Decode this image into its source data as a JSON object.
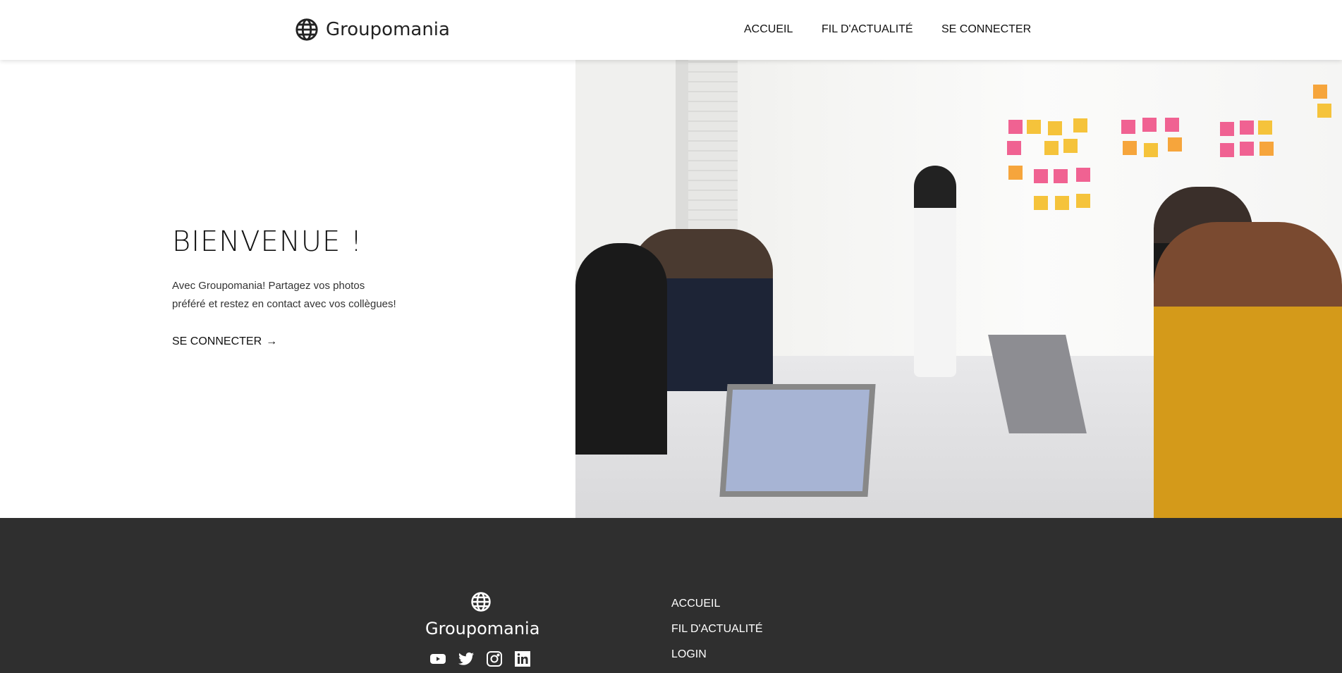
{
  "header": {
    "brand": "Groupomania",
    "nav": [
      "ACCUEIL",
      "FIL D'ACTUALITÉ",
      "SE CONNECTER"
    ]
  },
  "hero": {
    "title": "BIENVENUE !",
    "text_line1": "Avec Groupomania! Partagez vos photos",
    "text_line2": "préféré et restez en contact avec vos collègues!",
    "cta": "SE CONNECTER",
    "cta_icon": "arrow-right-icon"
  },
  "footer": {
    "brand": "Groupomania",
    "links": [
      "ACCUEIL",
      "FIL D'ACTUALITÉ",
      "LOGIN"
    ],
    "socials": [
      "youtube-icon",
      "twitter-icon",
      "instagram-icon",
      "linkedin-icon"
    ]
  },
  "colors": {
    "footer_bg": "#2f2f2f",
    "text": "#111111"
  }
}
